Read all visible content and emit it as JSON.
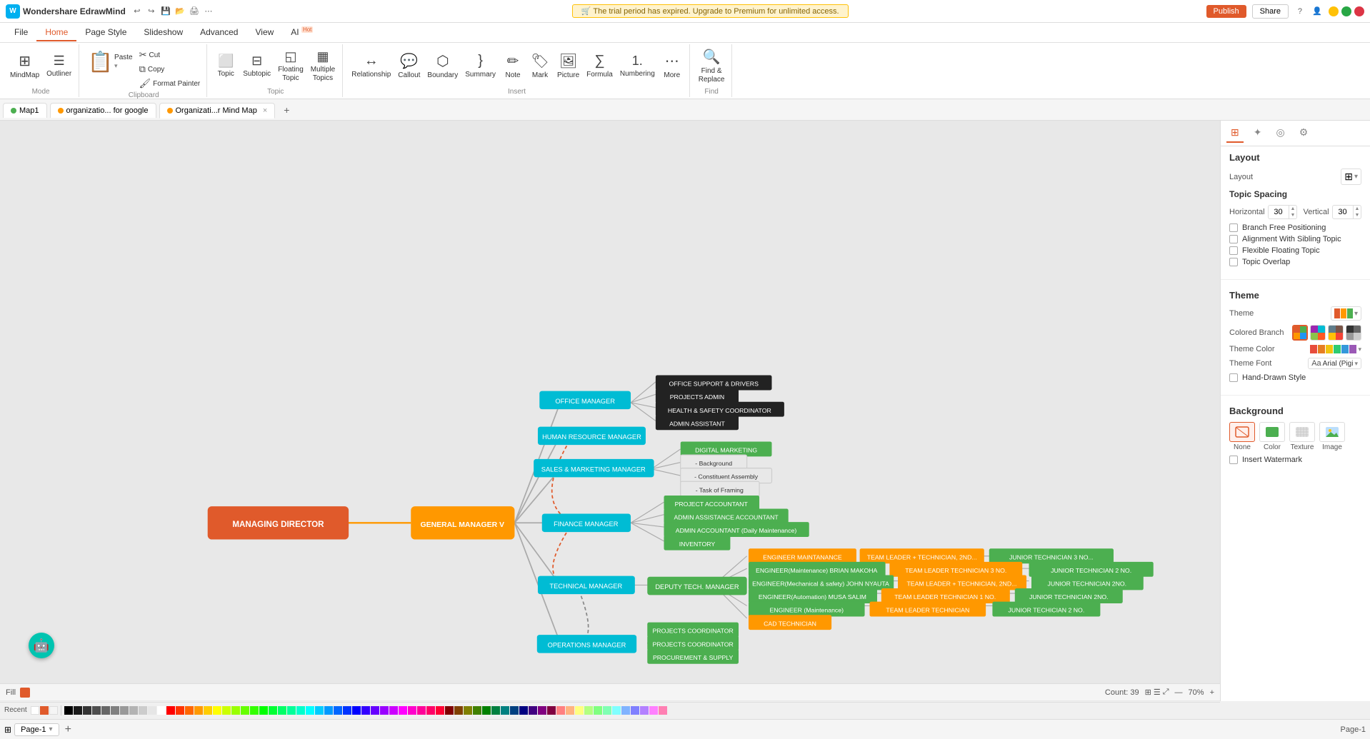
{
  "app": {
    "title": "Wondershare EdrawMind",
    "trial_banner": "🛒 The trial period has expired. Upgrade to Premium for unlimited access.",
    "publish_label": "Publish",
    "share_label": "Share"
  },
  "ribbon": {
    "tabs": [
      "File",
      "Home",
      "Page Style",
      "Slideshow",
      "Advanced",
      "View",
      "AI 🔥"
    ],
    "active_tab": "Home",
    "groups": [
      {
        "name": "Mode",
        "items": [
          {
            "id": "mindmap",
            "icon": "⊞",
            "label": "MindMap"
          },
          {
            "id": "outliner",
            "icon": "☰",
            "label": "Outliner"
          }
        ]
      },
      {
        "name": "Clipboard",
        "items": [
          {
            "id": "paste",
            "icon": "📋",
            "label": "Paste"
          },
          {
            "id": "cut",
            "icon": "✂",
            "label": "Cut"
          },
          {
            "id": "copy",
            "icon": "⧉",
            "label": "Copy"
          },
          {
            "id": "format-painter",
            "icon": "🖌",
            "label": "Format Painter"
          }
        ]
      },
      {
        "name": "Topic",
        "items": [
          {
            "id": "topic",
            "icon": "⬜",
            "label": "Topic"
          },
          {
            "id": "subtopic",
            "icon": "⬛",
            "label": "Subtopic"
          },
          {
            "id": "floating-topic",
            "icon": "◻",
            "label": "Floating Topic"
          },
          {
            "id": "multiple-topics",
            "icon": "▦",
            "label": "Multiple Topics"
          }
        ]
      },
      {
        "name": "Insert",
        "items": [
          {
            "id": "relationship",
            "icon": "↔",
            "label": "Relationship"
          },
          {
            "id": "callout",
            "icon": "💬",
            "label": "Callout"
          },
          {
            "id": "boundary",
            "icon": "⬡",
            "label": "Boundary"
          },
          {
            "id": "summary",
            "icon": "}",
            "label": "Summary"
          },
          {
            "id": "note",
            "icon": "✏",
            "label": "Note"
          },
          {
            "id": "mark",
            "icon": "🏷",
            "label": "Mark"
          },
          {
            "id": "picture",
            "icon": "🖼",
            "label": "Picture"
          },
          {
            "id": "formula",
            "icon": "∑",
            "label": "Formula"
          },
          {
            "id": "numbering",
            "icon": "1.",
            "label": "Numbering"
          },
          {
            "id": "more",
            "icon": "⋯",
            "label": "More"
          }
        ]
      },
      {
        "name": "Find",
        "items": [
          {
            "id": "find-replace",
            "icon": "🔍",
            "label": "Find &\nReplace"
          }
        ]
      }
    ]
  },
  "tabs": [
    {
      "id": "map1",
      "label": "Map1",
      "dot": "green",
      "closable": false
    },
    {
      "id": "organizatio-google",
      "label": "organizatio... for google",
      "dot": "orange",
      "closable": false
    },
    {
      "id": "organizatir-mindmap",
      "label": "Organizati...r Mind Map",
      "dot": "orange",
      "closable": true,
      "active": true
    }
  ],
  "right_panel": {
    "tabs": [
      "grid",
      "star",
      "target",
      "settings"
    ],
    "active_tab": "grid",
    "layout": {
      "title": "Layout",
      "layout_label": "Layout",
      "layout_icon": "⊞",
      "topic_spacing": {
        "title": "Topic Spacing",
        "horizontal_label": "Horizontal",
        "horizontal_value": "30",
        "vertical_label": "Vertical",
        "vertical_value": "30"
      },
      "checkboxes": [
        {
          "id": "branch-free",
          "label": "Branch Free Positioning",
          "checked": false
        },
        {
          "id": "alignment-sibling",
          "label": "Alignment With Sibling Topic",
          "checked": false
        },
        {
          "id": "flexible-floating",
          "label": "Flexible Floating Topic",
          "checked": false
        },
        {
          "id": "topic-overlap",
          "label": "Topic Overlap",
          "checked": false
        }
      ]
    },
    "theme": {
      "title": "Theme",
      "theme_label": "Theme",
      "colored_branch_label": "Colored Branch",
      "theme_color_label": "Theme Color",
      "theme_font_label": "Theme Font",
      "theme_font_value": "Arial (Pigi",
      "hand_drawn_label": "Hand-Drawn Style",
      "hand_drawn_checked": false,
      "colors": [
        "#e74c3c",
        "#e67e22",
        "#f1c40f",
        "#2ecc71",
        "#1abc9c",
        "#3498db",
        "#9b59b6",
        "#e91e63",
        "#795548"
      ]
    },
    "background": {
      "title": "Background",
      "options": [
        {
          "id": "none",
          "label": "None",
          "active": true
        },
        {
          "id": "color",
          "label": "Color"
        },
        {
          "id": "texture",
          "label": "Texture"
        },
        {
          "id": "image",
          "label": "Image"
        }
      ],
      "insert_watermark_label": "Insert Watermark"
    }
  },
  "bottom": {
    "fill_label": "Fill",
    "page_label": "Page-1",
    "count_label": "Count: 39",
    "zoom_label": "70%"
  },
  "mindmap": {
    "central_node": "MANAGING DIRECTOR",
    "nodes": [
      {
        "id": "gm",
        "label": "GENERAL MANAGER V",
        "color": "#ff9800"
      },
      {
        "id": "office",
        "label": "OFFICE MANAGER",
        "color": "#00bcd4"
      },
      {
        "id": "hr",
        "label": "HUMAN RESOURCE MANAGER",
        "color": "#00bcd4"
      },
      {
        "id": "sales",
        "label": "SALES & MARKETING MANAGER",
        "color": "#00bcd4"
      },
      {
        "id": "finance",
        "label": "FINANCE MANAGER",
        "color": "#00bcd4"
      },
      {
        "id": "technical",
        "label": "TECHNICAL MANAGER",
        "color": "#00bcd4"
      },
      {
        "id": "operations",
        "label": "OPERATIONS MANAGER",
        "color": "#00bcd4"
      },
      {
        "id": "office_support",
        "label": "OFFICE SUPPORT & DRIVERS",
        "color": "#333"
      },
      {
        "id": "projects_admin",
        "label": "PROJECTS ADMIN",
        "color": "#333"
      },
      {
        "id": "health_safety",
        "label": "HEALTH & SAFETY COORDINATOR",
        "color": "#333"
      },
      {
        "id": "admin_assistant",
        "label": "ADMIN ASSISTANT",
        "color": "#333"
      },
      {
        "id": "digital_mktg",
        "label": "DIGITAL MARKETING",
        "color": "#4caf50"
      },
      {
        "id": "background",
        "label": "- Background",
        "color": "#fff"
      },
      {
        "id": "constituent",
        "label": "- Constituent Assembly",
        "color": "#fff"
      },
      {
        "id": "task_framing",
        "label": "- Task of Framing",
        "color": "#fff"
      },
      {
        "id": "project_acct",
        "label": "PROJECT ACCOUNTANT",
        "color": "#4caf50"
      },
      {
        "id": "admin_assist_acct",
        "label": "ADMIN ASSISTANCE ACCOUNTANT",
        "color": "#4caf50"
      },
      {
        "id": "admin_acct_daily",
        "label": "ADMIN ACCOUNTANT (Daily Maintenance)",
        "color": "#4caf50"
      },
      {
        "id": "inventory",
        "label": "INVENTORY",
        "color": "#4caf50"
      },
      {
        "id": "deputy_tech",
        "label": "DEPUTY TECH. MANAGER",
        "color": "#4caf50"
      },
      {
        "id": "eng_maintenance",
        "label": "ENGINEER MAINTANANCE",
        "color": "#ff9800"
      },
      {
        "id": "eng_brian",
        "label": "ENGINEER (Maintenance) BRIAN MAKOHA",
        "color": "#4caf50"
      },
      {
        "id": "eng_mechanical",
        "label": "ENGINEER (Mechanical & safety) JOHN NYAUTA",
        "color": "#4caf50"
      },
      {
        "id": "eng_automation",
        "label": "ENGINEER (Automation) MUSA SALIM",
        "color": "#4caf50"
      },
      {
        "id": "eng_maintenance2",
        "label": "ENGINEER (Maintenance)",
        "color": "#4caf50"
      },
      {
        "id": "cad_tech",
        "label": "CAD TECHNICIAN",
        "color": "#ff9800"
      },
      {
        "id": "team_lead_tech_2nd",
        "label": "TEAM LEADER + TECHNICIAN, 2ND...",
        "color": "#ff9800"
      },
      {
        "id": "team_lead_tech3_no",
        "label": "TEAM LEADER TECHNICIAN 3 NO.",
        "color": "#ff9800"
      },
      {
        "id": "team_lead_tech4_2nd",
        "label": "TEAM LEADER + TECHNICIAN, 2ND...",
        "color": "#ff9800"
      },
      {
        "id": "team_lead_tech1_no",
        "label": "TEAM LEADER TECHNICIAN 1 NO.",
        "color": "#ff9800"
      },
      {
        "id": "team_lead_tech",
        "label": "TEAM LEADER TECHNICIAN",
        "color": "#ff9800"
      },
      {
        "id": "junior_tech3",
        "label": "JUNIOR TECHNICIAN 3 NO...",
        "color": "#4caf50"
      },
      {
        "id": "junior_tech2_2nd",
        "label": "JUNIOR TECHNICIAN 2 NO.",
        "color": "#4caf50"
      },
      {
        "id": "junior_tech2no",
        "label": "JUNIOR TECHNICIAN 2NO.",
        "color": "#4caf50"
      },
      {
        "id": "junior_tech2_no2",
        "label": "JUNIOR TECHICIAN 2 NO.",
        "color": "#4caf50"
      },
      {
        "id": "projects_coord1",
        "label": "PROJECTS COORDINATOR",
        "color": "#4caf50"
      },
      {
        "id": "projects_coord2",
        "label": "PROJECTS COORDINATOR",
        "color": "#4caf50"
      },
      {
        "id": "procurement",
        "label": "PROCUREMENT & SUPPLY",
        "color": "#4caf50"
      }
    ]
  }
}
